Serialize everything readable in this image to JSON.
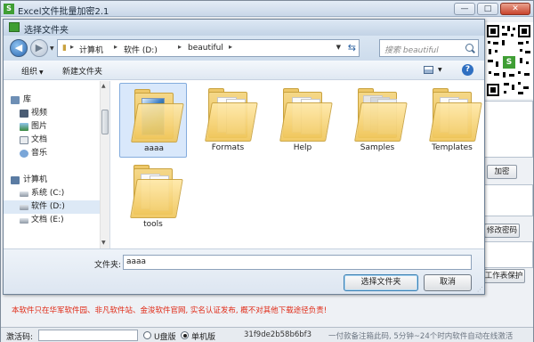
{
  "app": {
    "title": "Excel文件批量加密2.1",
    "logo": "S",
    "minimize_label": "—",
    "restore_label": "□",
    "close_label": "✕",
    "qr_mark": "S",
    "encrypt_button": "加密",
    "change_password_button": "修改密码",
    "sheet_protect_button": "工作表保护",
    "notice": "本软件只在华军软件园、非凡软件站、金浚软件官网, 实名认证发布, 概不对其他下载途径负责!",
    "activation_label": "激活码:",
    "activation_value": "",
    "radio_usb": "U盘版",
    "radio_single": "单机版",
    "selected_mode": "单机版",
    "machine_code": "31f9de2b58b6bf3",
    "status_hint": "一付款备注箱此码, 5分钟~24个时内软件自动在线激活"
  },
  "dialog": {
    "title": "选择文件夹",
    "back_label": "◀",
    "forward_label": "▶",
    "breadcrumbs": [
      "计算机",
      "软件 (D:)",
      "beautiful"
    ],
    "search_placeholder": "搜索 beautiful",
    "toolbar": {
      "organize": "组织",
      "new_folder": "新建文件夹"
    },
    "nav": {
      "library_label": "库",
      "libraries": [
        "视频",
        "图片",
        "文档",
        "音乐"
      ],
      "computer_label": "计算机",
      "drives": [
        "系统 (C:)",
        "软件 (D:)",
        "文档 (E:)"
      ],
      "selected_drive": "软件 (D:)"
    },
    "folders": [
      {
        "name": "aaaa",
        "selected": true
      },
      {
        "name": "Formats",
        "selected": false
      },
      {
        "name": "Help",
        "selected": false
      },
      {
        "name": "Samples",
        "selected": false
      },
      {
        "name": "Templates",
        "selected": false
      },
      {
        "name": "tools",
        "selected": false
      }
    ],
    "filename_label": "文件夹:",
    "filename_value": "aaaa",
    "select_button": "选择文件夹",
    "cancel_button": "取消"
  },
  "colors": {
    "accent": "#3c7fb1",
    "notice": "#e02a16",
    "brand": "#3f9e34",
    "folder": "#f0c659"
  }
}
